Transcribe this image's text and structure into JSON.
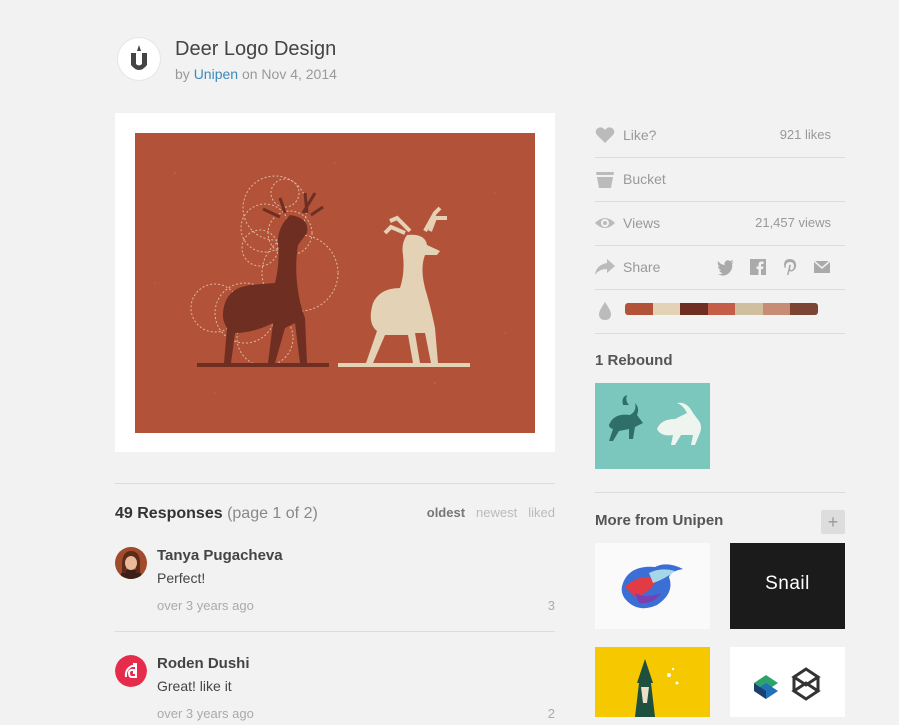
{
  "shot": {
    "title": "Deer Logo Design",
    "by_prefix": "by",
    "author": "Unipen",
    "on_prefix": "on",
    "date": "Nov 4, 2014"
  },
  "responses": {
    "count_label": "49 Responses",
    "page_label": "(page 1 of 2)",
    "sort": [
      "oldest",
      "newest",
      "liked"
    ],
    "active_sort": "oldest",
    "items": [
      {
        "name": "Tanya Pugacheva",
        "text": "Perfect!",
        "time": "over 3 years ago",
        "likes": "3"
      },
      {
        "name": "Roden Dushi",
        "text": "Great! like it",
        "time": "over 3 years ago",
        "likes": "2"
      }
    ]
  },
  "sidebar": {
    "like": {
      "label": "Like?",
      "value": "921 likes"
    },
    "bucket": {
      "label": "Bucket"
    },
    "views": {
      "label": "Views",
      "value": "21,457 views"
    },
    "share": {
      "label": "Share",
      "icons": [
        "twitter-icon",
        "facebook-icon",
        "pinterest-icon",
        "email-icon"
      ]
    },
    "palette": [
      "#b25239",
      "#e3d2b5",
      "#6e2f22",
      "#c35f48",
      "#cfbf9f",
      "#c78c73",
      "#7c4433"
    ],
    "rebound_title": "1 Rebound",
    "more_title": "More from Unipen",
    "more_plus": "+",
    "snail_text": "Snail"
  }
}
